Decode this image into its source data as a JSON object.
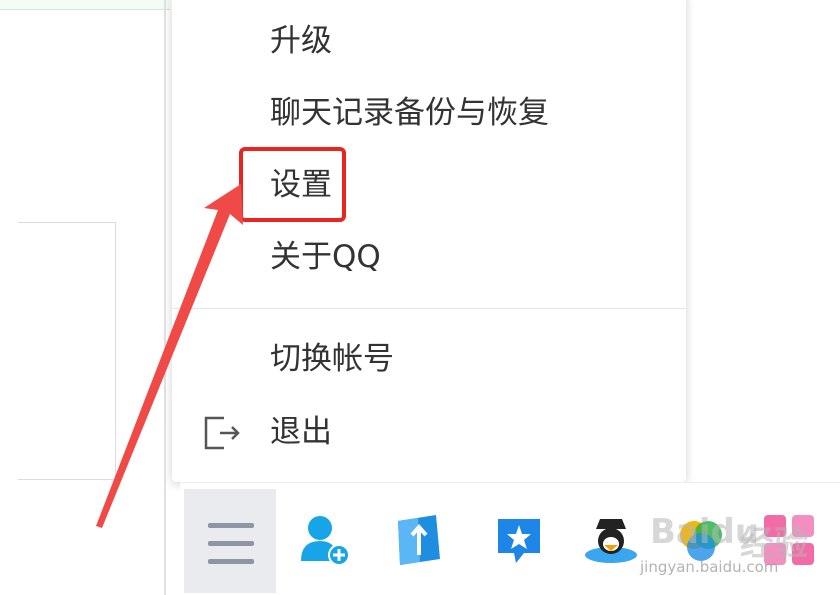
{
  "menu": {
    "items": {
      "upgrade": "升级",
      "backup": "聊天记录备份与恢复",
      "settings": "设置",
      "about": "关于QQ",
      "switch_account": "切换帐号",
      "exit": "退出"
    }
  },
  "annotation": {
    "highlight_color": "#e8251f",
    "highlighted_item": "settings"
  },
  "toolbar": {
    "icons": [
      "menu-icon",
      "add-friend-icon",
      "app-manager-icon",
      "qq-star-icon",
      "penguin-game-icon",
      "colorful-app-icon",
      "pink-app-icon"
    ]
  },
  "watermark": {
    "logo": "Baidu",
    "jy": "经验",
    "url": "jingyan.baidu.com"
  }
}
